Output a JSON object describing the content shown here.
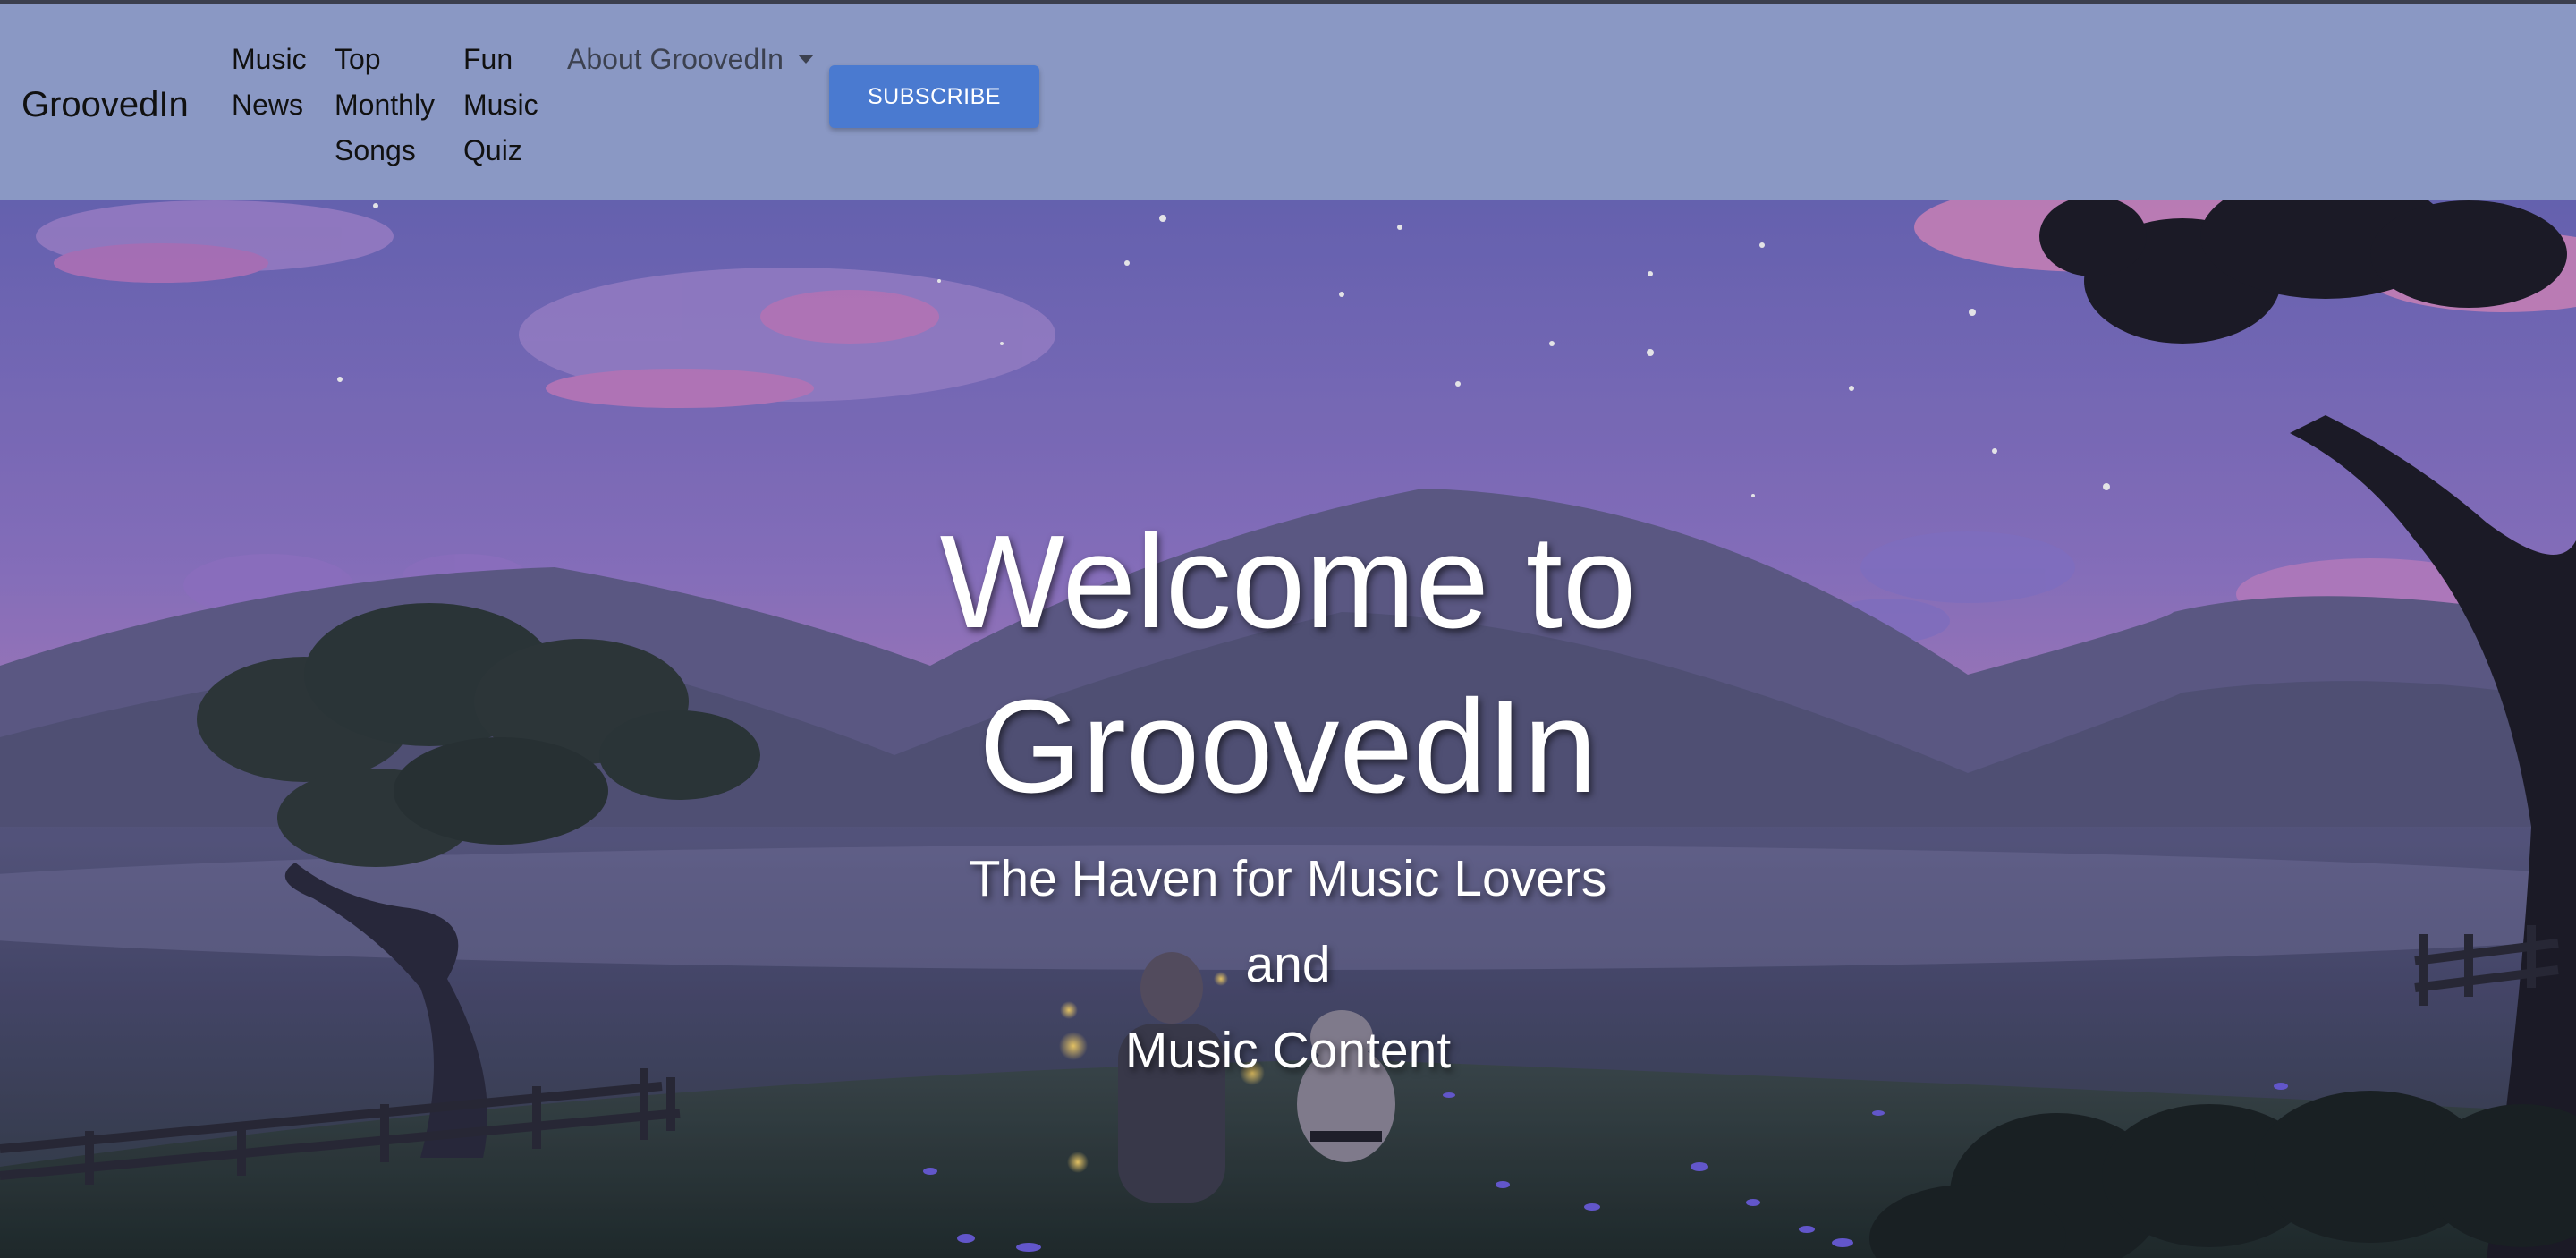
{
  "navbar": {
    "brand": "GroovedIn",
    "items": [
      {
        "label": "Music News"
      },
      {
        "label": "Top Monthly Songs"
      },
      {
        "label": "Fun Music Quiz"
      }
    ],
    "dropdown_label": "About GroovedIn",
    "subscribe_label": "SUBSCRIBE",
    "colors": {
      "background": "#8a98c4",
      "button": "#4a7ad0"
    }
  },
  "hero": {
    "title_line1": "Welcome to",
    "title_line2": "GroovedIn",
    "subtitle_line1": "The Haven for Music Lovers",
    "subtitle_line2": "and",
    "subtitle_line3": "Music Content"
  }
}
